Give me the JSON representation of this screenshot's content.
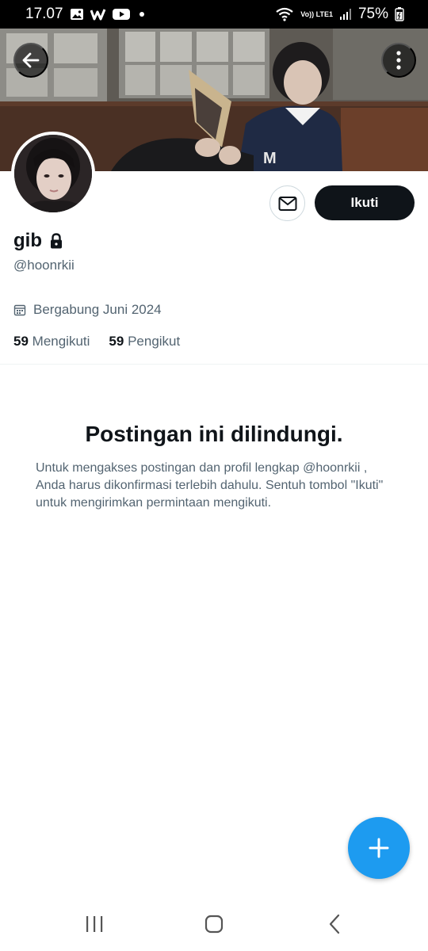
{
  "status_bar": {
    "time": "17.07",
    "network_label": "Vo)) LTE1",
    "battery": "75%"
  },
  "icons": {
    "back": "arrow-left-icon",
    "more": "more-vertical-icon",
    "message": "envelope-icon",
    "lock": "lock-icon",
    "calendar": "calendar-icon",
    "compose": "plus-icon"
  },
  "profile": {
    "display_name": "gib",
    "handle": "@hoonrkii",
    "joined": "Bergabung Juni 2024",
    "following_count": "59",
    "following_label": "Mengikuti",
    "followers_count": "59",
    "followers_label": "Pengikut"
  },
  "actions": {
    "follow_label": "Ikuti"
  },
  "protected_notice": {
    "title": "Postingan ini dilindungi.",
    "description": "Untuk mengakses postingan dan profil lengkap @hoonrkii , Anda harus dikonfirmasi terlebih dahulu. Sentuh tombol \"Ikuti\" untuk mengirimkan permintaan mengikuti."
  },
  "colors": {
    "accent": "#1d9bf0",
    "text_primary": "#0f1419",
    "text_secondary": "#536471",
    "follow_button": "#0f1419"
  }
}
